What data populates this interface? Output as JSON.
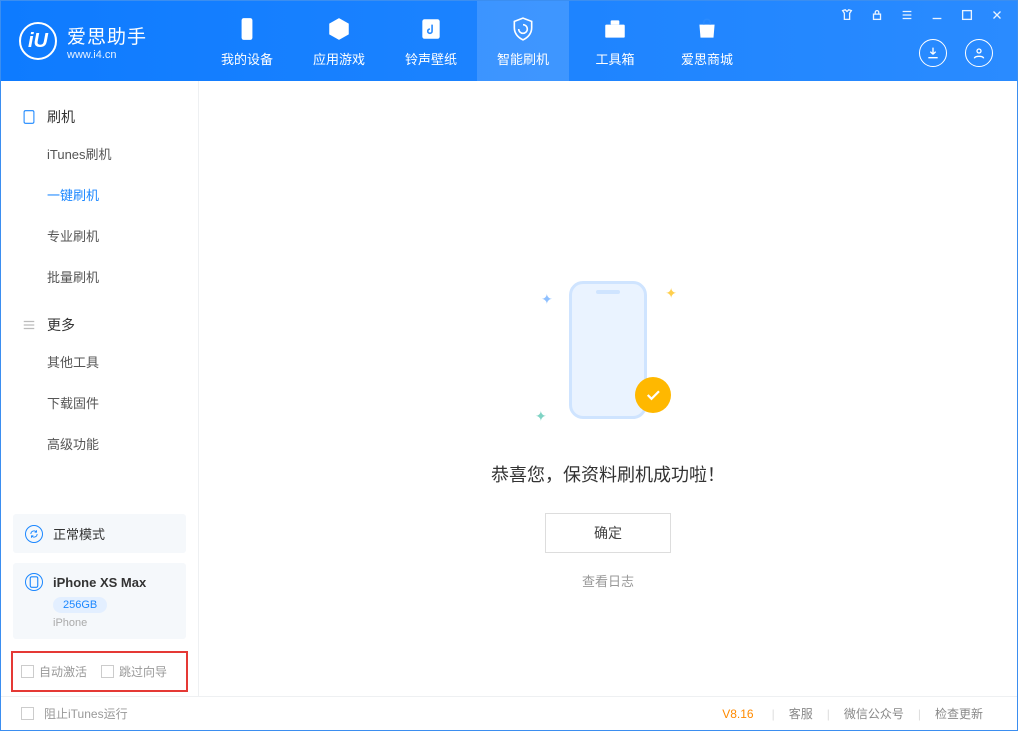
{
  "app": {
    "title": "爱思助手",
    "subtitle": "www.i4.cn"
  },
  "nav": {
    "tabs": [
      {
        "label": "我的设备"
      },
      {
        "label": "应用游戏"
      },
      {
        "label": "铃声壁纸"
      },
      {
        "label": "智能刷机"
      },
      {
        "label": "工具箱"
      },
      {
        "label": "爱思商城"
      }
    ]
  },
  "sidebar": {
    "group1": {
      "title": "刷机",
      "items": [
        "iTunes刷机",
        "一键刷机",
        "专业刷机",
        "批量刷机"
      ],
      "activeIndex": 1
    },
    "group2": {
      "title": "更多",
      "items": [
        "其他工具",
        "下载固件",
        "高级功能"
      ]
    },
    "mode": {
      "label": "正常模式"
    },
    "device": {
      "name": "iPhone XS Max",
      "storage": "256GB",
      "type": "iPhone"
    },
    "checks": {
      "autoActivate": "自动激活",
      "skipGuide": "跳过向导"
    }
  },
  "main": {
    "successText": "恭喜您，保资料刷机成功啦！",
    "confirmBtn": "确定",
    "viewLog": "查看日志"
  },
  "footer": {
    "blockItunes": "阻止iTunes运行",
    "version": "V8.16",
    "links": [
      "客服",
      "微信公众号",
      "检查更新"
    ]
  }
}
